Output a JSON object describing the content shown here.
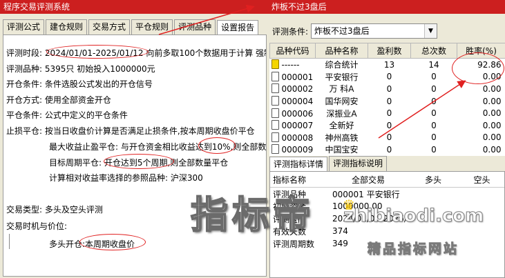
{
  "left_window": {
    "title": "程序交易评测系统",
    "tabs": [
      "评测公式",
      "建仓规则",
      "交易方式",
      "平仓规则",
      "评测品种",
      "设置报告"
    ],
    "active_tab": 5,
    "lines": [
      "评测时段: 2024/01/01-2025/01/12 向前多取100个数据用于计算 强制",
      "评测品种: 5395只 初始投入1000000元",
      "开仓条件: 条件选股公式发出的开仓信号",
      "开仓方式: 使用全部资金开仓",
      "平仓条件: 公式中定义的平仓条件",
      "止损平仓: 按当日收盘价计算是否满足止损条件,按本周期收盘价平仓",
      "最大收益止盈平仓: 与开仓资金相比收益达到10%,则全部数",
      "目标周期平仓: 开仓达到5个周期,则全部数量平仓",
      "计算相对收益率选择的参照品种: 沪深300",
      "交易类型: 多头及空头评测",
      "交易时机与价位:",
      "多头开仓:本周期收盘价"
    ]
  },
  "right_window": {
    "title": "炸板不过3盘后",
    "condition_label": "评测条件:",
    "condition_value": "炸板不过3盘后",
    "columns": [
      "品种代码",
      "品种名称",
      "盈利数",
      "总次数",
      "胜率(%)"
    ],
    "rows": [
      [
        "------",
        "综合统计",
        "13",
        "14",
        "92.86"
      ],
      [
        "000001",
        "平安银行",
        "0",
        "0",
        "0.00"
      ],
      [
        "000002",
        "万 科A",
        "0",
        "0",
        "0.00"
      ],
      [
        "000004",
        "国华网安",
        "0",
        "0",
        "0.00"
      ],
      [
        "000006",
        "深振业A",
        "0",
        "0",
        "0.00"
      ],
      [
        "000007",
        "全新好",
        "0",
        "0",
        "0.00"
      ],
      [
        "000008",
        "神州高铁",
        "0",
        "0",
        "0.00"
      ],
      [
        "000009",
        "中国宝安",
        "0",
        "0",
        "0.00"
      ]
    ],
    "sub_tabs": [
      "评测指标详情",
      "评测指标说明"
    ],
    "detail_columns": [
      "指标名称",
      "全部交易",
      "多头",
      "空头"
    ],
    "detail_rows": [
      [
        "评测品种",
        "000001 平安银行",
        "",
        ""
      ],
      [
        "初始资金",
        "1000000.00",
        "",
        ""
      ],
      [
        "评测区间",
        "2024/01/01-2025/01/12",
        "",
        ""
      ],
      [
        "有效天数",
        "374",
        "",
        ""
      ],
      [
        "评测周期数",
        "349",
        "",
        ""
      ]
    ]
  },
  "watermark": {
    "big": "指标帝",
    "url": "zhibiaodi.com",
    "slogan": "精品指标网站"
  },
  "colors": {
    "titlebar": "#cc1f1f",
    "annotation": "#e02020"
  }
}
